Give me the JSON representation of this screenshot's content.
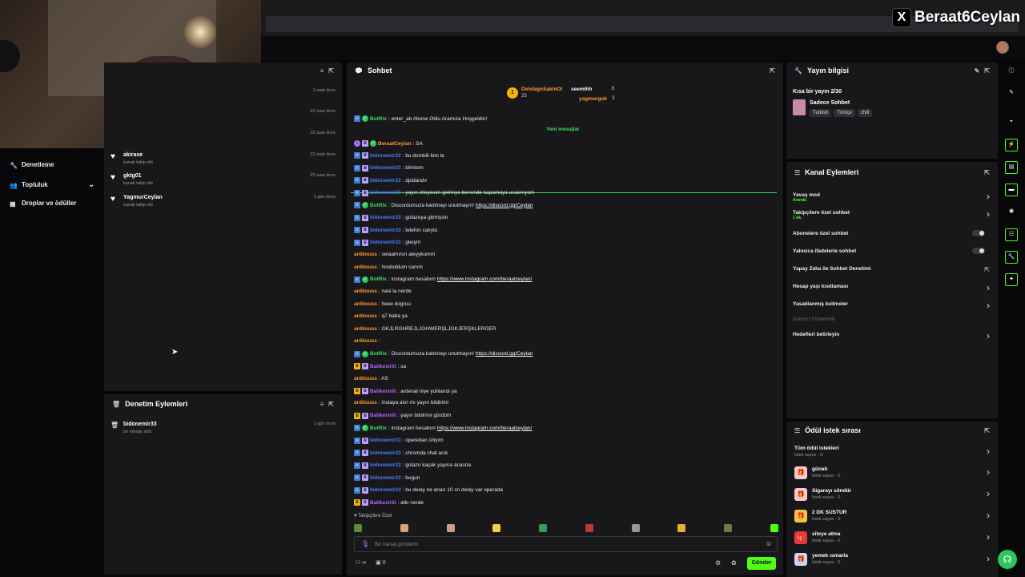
{
  "overlay": {
    "x_handle": "Beraat6Ceylan",
    "x_logo": "X"
  },
  "left_nav": {
    "items": [
      {
        "label": "Denetleme",
        "icon": "wrench-icon"
      },
      {
        "label": "Topluluk",
        "icon": "users-icon"
      },
      {
        "label": "Droplar ve ödüller",
        "icon": "gift-icon"
      }
    ]
  },
  "activity": {
    "rows": [
      {
        "time": "1 saat önce"
      },
      {
        "time": "22 saat önce"
      },
      {
        "time": "22 saat önce"
      },
      {
        "name": "akirase",
        "sub": "kanalı takip etti",
        "time": "22 saat önce"
      },
      {
        "name": "gktg01",
        "sub": "kanalı takip etti",
        "time": "22 saat önce"
      },
      {
        "name": "YagmurCeylan",
        "sub": "kanalı takip etti",
        "time": "1 gün önce"
      }
    ]
  },
  "mod_actions": {
    "title": "Denetim Eylemleri",
    "rows": [
      {
        "name": "bidonemir33",
        "sub": "bir mesajı sildi",
        "time": "1 gün önce"
      }
    ]
  },
  "chat": {
    "title": "Sohbet",
    "pinned": {
      "top1_name": "DelvlagoSakinOl",
      "top1_count": "25",
      "top2_name": "seemihh",
      "top2_count": "6",
      "top3_name": "yagmurgok",
      "top3_count": "3"
    },
    "new_messages_label": "Yeni mesajlar",
    "first_msg": {
      "user": "BotRix",
      "text": ": enter_ab Abone Oldu Aramıza Hoşgeldin!"
    },
    "messages": [
      {
        "user": "BeraatCeylan",
        "text": ": SA",
        "cls": "u-orange"
      },
      {
        "user": "bidonemir33",
        "text": ": bu dombili kim la",
        "cls": "u-blue"
      },
      {
        "user": "bidonemir33",
        "text": ": bilmiom",
        "cls": "u-blue"
      },
      {
        "user": "bidonemir33",
        "text": ": dpidandır",
        "cls": "u-blue"
      },
      {
        "user": "bidonemir33",
        "text": ": yayın izleyesim gelmıyo benımde kapamaya usaenıyom",
        "cls": "u-blue"
      },
      {
        "user": "BotRix",
        "text": ": Discordumuza katılmayı unutmayın! ",
        "link": "https://discord.gg/Ceylan",
        "cls": "u-bot"
      },
      {
        "user": "bidonemir33",
        "text": ": golazoya gitmişsin",
        "cls": "u-blue"
      },
      {
        "user": "bidonemir33",
        "text": ": telefon calıyto",
        "cls": "u-blue"
      },
      {
        "user": "bidonemir33",
        "text": ": gleıym",
        "cls": "u-blue"
      },
      {
        "user": "ardiiouss",
        "text": ": selaamının aleyykumm",
        "cls": "u-orange"
      },
      {
        "user": "ardiiouss",
        "text": ": hosbuldum canım",
        "cls": "u-orange"
      },
      {
        "user": "BotRix",
        "text": ": instagram hesabım ",
        "link": "https://www.instagram.com/beraatceylan/",
        "cls": "u-bot"
      },
      {
        "user": "ardiiouss",
        "text": ": nasi la nerde",
        "cls": "u-orange"
      },
      {
        "user": "ardiiouss",
        "text": ": heee dogruu",
        "cls": "u-orange"
      },
      {
        "user": "ardiiouss",
        "text": ": q7 baba ya",
        "cls": "u-orange"
      },
      {
        "user": "ardiiouss",
        "text": ": GKJLRGHREJLJGHWERŞLJGKJERŞKLERGER",
        "cls": "u-orange"
      },
      {
        "user": "ardiiouss",
        "text": ": ",
        "cls": "u-orange"
      },
      {
        "user": "BotRix",
        "text": ": Discordumuza katılmayı unutmayın! ",
        "link": "https://discord.gg/Ceylan",
        "cls": "u-bot"
      },
      {
        "user": "Balikesirlii",
        "text": ": sa",
        "cls": "u-purple"
      },
      {
        "user": "ardiiouss",
        "text": ": AS",
        "cls": "u-orange"
      },
      {
        "user": "Balikesirlii",
        "text": ": ardenal niye yuhlandı ya",
        "cls": "u-purple"
      },
      {
        "user": "ardiiouss",
        "text": ": instaya atın mı yayın bildirimi",
        "cls": "u-orange"
      },
      {
        "user": "Balikesirlii",
        "text": ": yayın bildirimi gördüm",
        "cls": "u-purple"
      },
      {
        "user": "BotRix",
        "text": ": instagram hesabım ",
        "link": "https://www.instagram.com/beraatceylan/",
        "cls": "u-bot"
      },
      {
        "user": "bidonemir33",
        "text": ": operedan izliyım",
        "cls": "u-blue"
      },
      {
        "user": "bidonemir33",
        "text": ": chromda chat acık",
        "cls": "u-blue"
      },
      {
        "user": "bidonemir33",
        "text": ": golazo kaçak yayına acasna",
        "cls": "u-blue"
      },
      {
        "user": "bidonemir33",
        "text": ": bugun",
        "cls": "u-blue"
      },
      {
        "user": "bidonemir33",
        "text": ": bu delay ne anarı 10 sn delay var operada",
        "cls": "u-blue"
      },
      {
        "user": "Balikesirlii",
        "text": ": atkı nerde",
        "cls": "u-purple"
      }
    ],
    "followers_only": "Takipçilere Özel",
    "input_placeholder": "Bir mesaj gönderin",
    "send_label": "Gönder",
    "count_label": "0"
  },
  "stream_info": {
    "title": "Yayın bilgisi",
    "stream_title": "Kısa bir yayın 2/30",
    "category": "Sadece Sohbet",
    "tags": [
      "Turkish",
      "Türkçe",
      "chill"
    ]
  },
  "channel_actions": {
    "title": "Kanal Eylemleri",
    "rows": [
      {
        "label": "Yavaş mod",
        "sub": "Anında",
        "kind": "chevron"
      },
      {
        "label": "Takipçilere özel sohbet",
        "sub": "1 dk.",
        "kind": "chevron"
      },
      {
        "label": "Abonelere özel sohbet",
        "kind": "toggle"
      },
      {
        "label": "Yalnızca ifadelerle sohbet",
        "kind": "toggle"
      },
      {
        "label": "Yapay Zeka ile Sohbet Denetimi",
        "kind": "external"
      },
      {
        "label": "Hesap yaşı kısıtlaması",
        "kind": "chevron"
      },
      {
        "label": "Yasaklanmış kelimeler",
        "kind": "chevron"
      },
      {
        "label": "İzleyici Yönlendir",
        "kind": "disabled"
      },
      {
        "label": "Hedefleri belirleyin",
        "kind": "chevron"
      }
    ]
  },
  "reward_queue": {
    "title": "Ödül istek sırası",
    "all_label": "Tüm ödül istekleri",
    "all_sub": "İstek sayısı - 0",
    "rows": [
      {
        "name": "günah",
        "sub": "İstek sayısı - 0",
        "color": "#f7c7d2"
      },
      {
        "name": "Sigarayı söndür",
        "sub": "İstek sayısı - 0",
        "color": "#f7c7d2"
      },
      {
        "name": "2 DK SUSTUR",
        "sub": "İstek sayısı - 0",
        "color": "#f5c542"
      },
      {
        "name": "siteye atma",
        "sub": "İstek sayısı - 0",
        "color": "#e8334a"
      },
      {
        "name": "yemek ısmarla",
        "sub": "İstek sayısı - 0",
        "color": "#c9d3ff"
      }
    ]
  },
  "colors": {
    "kick_green": "#53fc18",
    "panel_bg": "#18181b",
    "page_bg": "#070709"
  }
}
